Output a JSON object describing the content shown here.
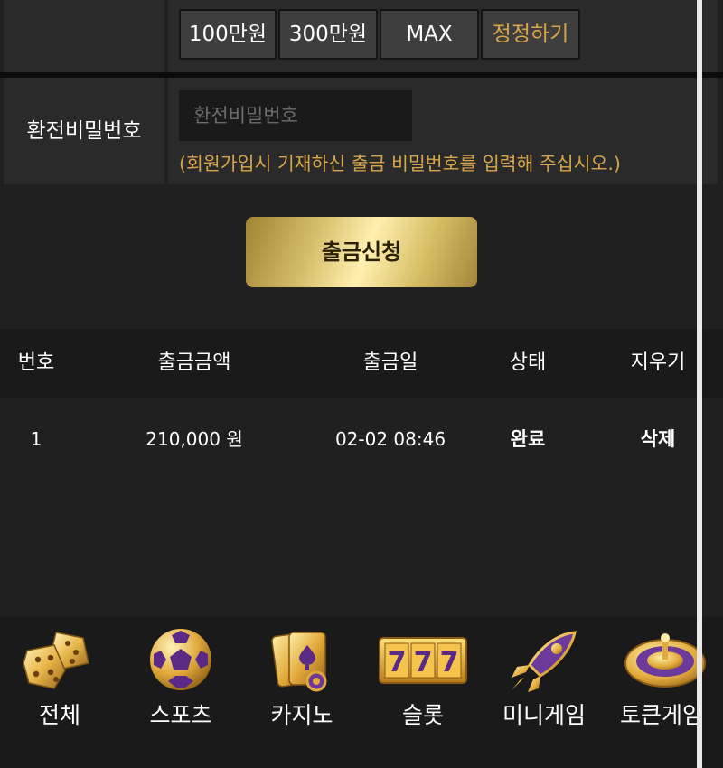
{
  "amount_buttons": [
    {
      "label": "100만원"
    },
    {
      "label": "300만원"
    },
    {
      "label": "MAX"
    },
    {
      "label": "정정하기"
    }
  ],
  "password": {
    "label": "환전비밀번호",
    "placeholder": "환전비밀번호",
    "note": "(회원가입시 기재하신 출금 비밀번호를 입력해 주십시오.)"
  },
  "submit_label": "출금신청",
  "table": {
    "headers": [
      "번호",
      "출금금액",
      "출금일",
      "상태",
      "지우기"
    ],
    "rows": [
      {
        "no": "1",
        "amount": "210,000 원",
        "date": "02-02 08:46",
        "status": "완료",
        "action": "삭제"
      }
    ]
  },
  "nav": [
    {
      "label": "전체",
      "icon": "dice-icon"
    },
    {
      "label": "스포츠",
      "icon": "soccer-ball-icon"
    },
    {
      "label": "카지노",
      "icon": "playing-cards-icon"
    },
    {
      "label": "슬롯",
      "icon": "slot-777-icon"
    },
    {
      "label": "미니게임",
      "icon": "rocket-icon"
    },
    {
      "label": "토큰게임",
      "icon": "roulette-icon"
    }
  ],
  "colors": {
    "background": "#202020",
    "cell": "#2a2a2a",
    "accent_gold": "#d9a54a",
    "nav_background": "#1a1a1a"
  }
}
